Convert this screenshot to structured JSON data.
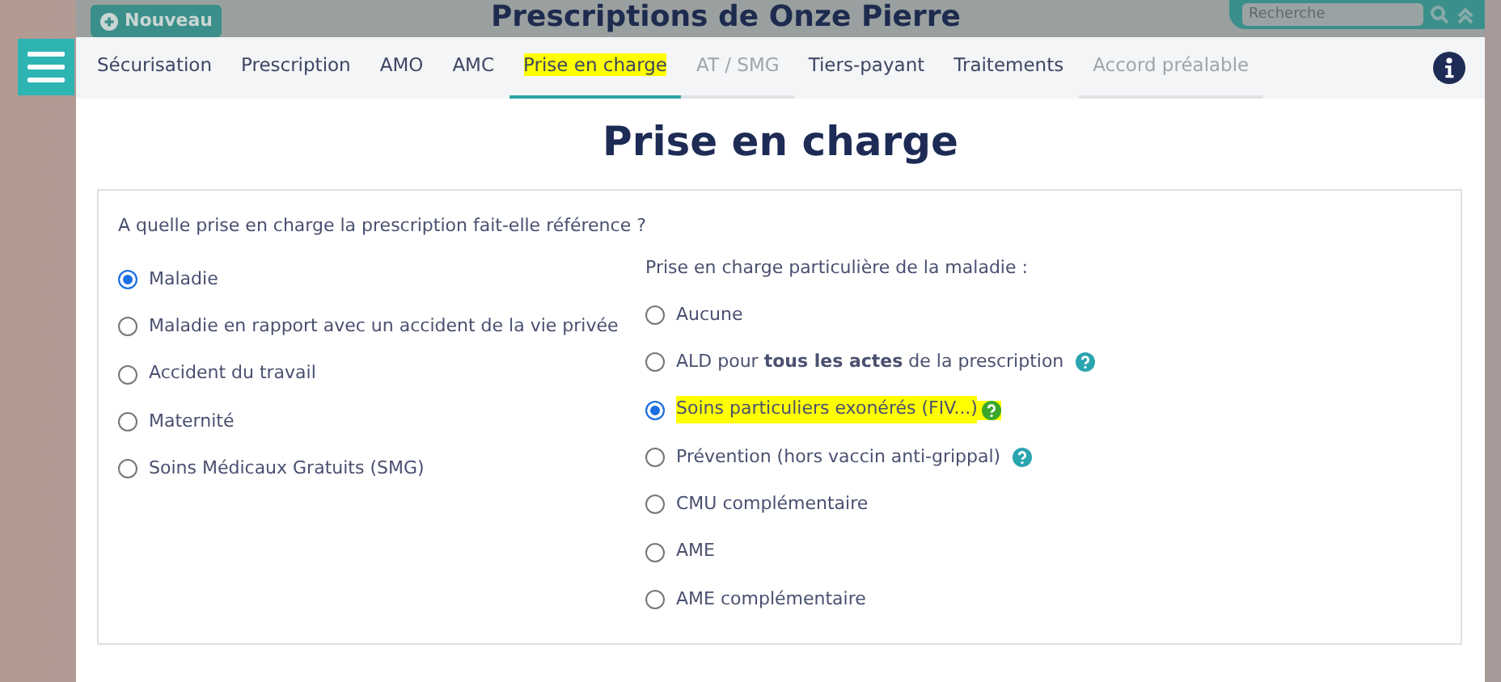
{
  "backdrop": {
    "new_button": "Nouveau",
    "title": "Prescriptions de Onze Pierre",
    "search": {
      "placeholder": "Recherche"
    }
  },
  "tabs": [
    {
      "label": "Sécurisation",
      "selected": false,
      "disabled": false,
      "highlighted": false
    },
    {
      "label": "Prescription",
      "selected": false,
      "disabled": false,
      "highlighted": false
    },
    {
      "label": "AMO",
      "selected": false,
      "disabled": false,
      "highlighted": false
    },
    {
      "label": "AMC",
      "selected": false,
      "disabled": false,
      "highlighted": false
    },
    {
      "label": "Prise en charge",
      "selected": true,
      "disabled": false,
      "highlighted": true
    },
    {
      "label": "AT / SMG",
      "selected": false,
      "disabled": true,
      "highlighted": false
    },
    {
      "label": "Tiers-payant",
      "selected": false,
      "disabled": false,
      "highlighted": false
    },
    {
      "label": "Traitements",
      "selected": false,
      "disabled": false,
      "highlighted": false
    },
    {
      "label": "Accord préalable",
      "selected": false,
      "disabled": true,
      "highlighted": false
    }
  ],
  "heading": "Prise en charge",
  "question": "A quelle prise en charge la prescription fait-elle référence ?",
  "coverage_options": [
    {
      "label": "Maladie",
      "selected": true
    },
    {
      "label": "Maladie en rapport avec un accident de la vie privée",
      "selected": false
    },
    {
      "label": "Accident du travail",
      "selected": false
    },
    {
      "label": "Maternité",
      "selected": false
    },
    {
      "label": "Soins Médicaux Gratuits (SMG)",
      "selected": false
    }
  ],
  "special_heading": "Prise en charge particulière de la maladie :",
  "special_options": [
    {
      "label": "Aucune",
      "selected": false,
      "help": false,
      "highlighted": false
    },
    {
      "label": "ALD pour **tous les actes** de la prescription",
      "selected": false,
      "help": true,
      "highlighted": false
    },
    {
      "label": "Soins particuliers exonérés (FIV...)",
      "selected": true,
      "help": true,
      "highlighted": true
    },
    {
      "label": "Prévention (hors vaccin anti-grippal)",
      "selected": false,
      "help": true,
      "highlighted": false
    },
    {
      "label": "CMU complémentaire",
      "selected": false,
      "help": false,
      "highlighted": false
    },
    {
      "label": "AME",
      "selected": false,
      "help": false,
      "highlighted": false
    },
    {
      "label": "AME complémentaire",
      "selected": false,
      "help": false,
      "highlighted": false
    }
  ]
}
